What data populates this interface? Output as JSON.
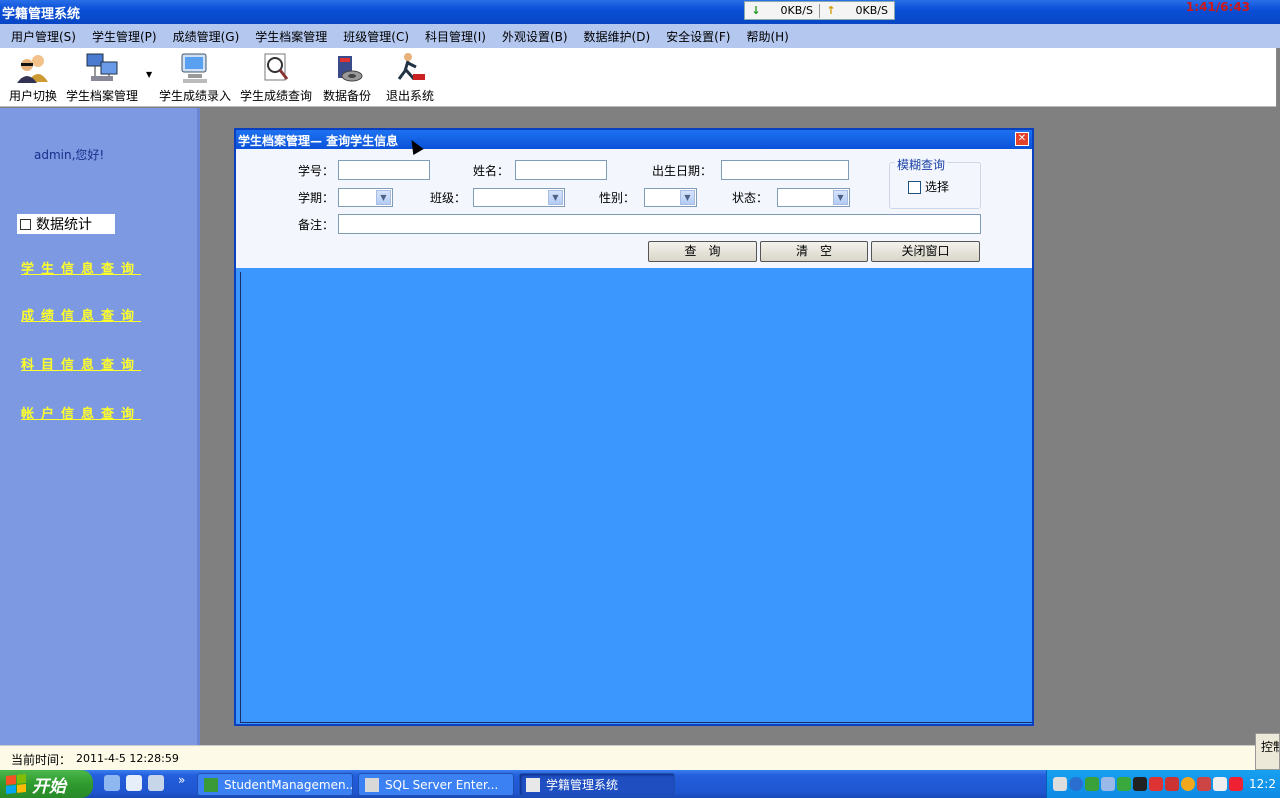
{
  "app": {
    "title": "学籍管理系统"
  },
  "netmeter": {
    "down": "0KB/S",
    "up": "0KB/S"
  },
  "top_clock": "1:41/6:43",
  "menu": [
    "用户管理(S)",
    "学生管理(P)",
    "成绩管理(G)",
    "学生档案管理",
    "班级管理(C)",
    "科目管理(I)",
    "外观设置(B)",
    "数据维护(D)",
    "安全设置(F)",
    "帮助(H)"
  ],
  "toolbar": [
    {
      "label": "用户切换",
      "icon": "users-switch-icon"
    },
    {
      "label": "学生档案管理",
      "icon": "network-computers-icon"
    },
    {
      "label": "学生成绩录入",
      "icon": "computer-entry-icon"
    },
    {
      "label": "学生成绩查询",
      "icon": "magnifier-query-icon"
    },
    {
      "label": "数据备份",
      "icon": "database-backup-icon"
    },
    {
      "label": "退出系统",
      "icon": "exit-runner-icon"
    }
  ],
  "sidebar": {
    "greeting": "admin,您好!",
    "stats_label": "数据统计",
    "links": [
      "学生信息查询",
      "成绩信息查询",
      "科目信息查询",
      "帐户信息查询"
    ]
  },
  "dialog": {
    "title": "学生档案管理— 查询学生信息",
    "labels": {
      "student_no": "学号：",
      "name": "姓名：",
      "birth": "出生日期：",
      "term": "学期：",
      "class": "班级：",
      "gender": "性别：",
      "status": "状态：",
      "remark": "备注："
    },
    "values": {
      "student_no": "",
      "name": "",
      "birth": "",
      "term": "",
      "class": "",
      "gender": "",
      "status": "",
      "remark": ""
    },
    "fuzzy": {
      "legend": "模糊查询",
      "checkbox_label": "选择",
      "checked": false
    },
    "buttons": {
      "query": "查　询",
      "clear": "清　空",
      "close": "关闭窗口"
    }
  },
  "statusbar": {
    "label": "当前时间：",
    "time": "2011-4-5 12:28:59",
    "ctl_fragment": "控制"
  },
  "taskbar": {
    "start": "开始",
    "tasks": [
      "StudentManagemen...",
      "SQL Server Enter...",
      "学籍管理系统"
    ],
    "clock": "12:2"
  },
  "colors": {
    "sidebar": "#7c99e2",
    "dialog_body": "#3b96fe",
    "link": "#ffff2a",
    "taskbar": "#245edb"
  }
}
